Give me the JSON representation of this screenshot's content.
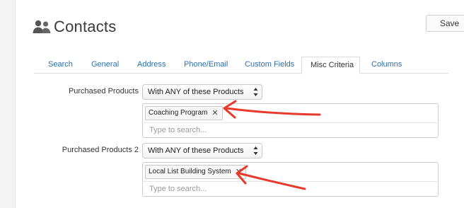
{
  "header": {
    "title": "Contacts",
    "icon": "contacts-icon"
  },
  "toolbar": {
    "save_label": "Save"
  },
  "tabs": [
    {
      "label": "Search",
      "active": false
    },
    {
      "label": "General",
      "active": false
    },
    {
      "label": "Address",
      "active": false
    },
    {
      "label": "Phone/Email",
      "active": false
    },
    {
      "label": "Custom Fields",
      "active": false
    },
    {
      "label": "Misc Criteria",
      "active": true
    },
    {
      "label": "Columns",
      "active": false
    }
  ],
  "criteria": [
    {
      "label": "Purchased Products",
      "match_select": "With ANY of these Products",
      "tags": [
        "Coaching Program"
      ],
      "search_placeholder": "Type to search..."
    },
    {
      "label": "Purchased Products 2",
      "match_select": "With ANY of these Products",
      "tags": [
        "Local List Building System"
      ],
      "search_placeholder": "Type to search..."
    }
  ],
  "colors": {
    "link": "#2f6fa8",
    "annotation_arrow": "#e8392c",
    "border": "#cfcfcf"
  }
}
